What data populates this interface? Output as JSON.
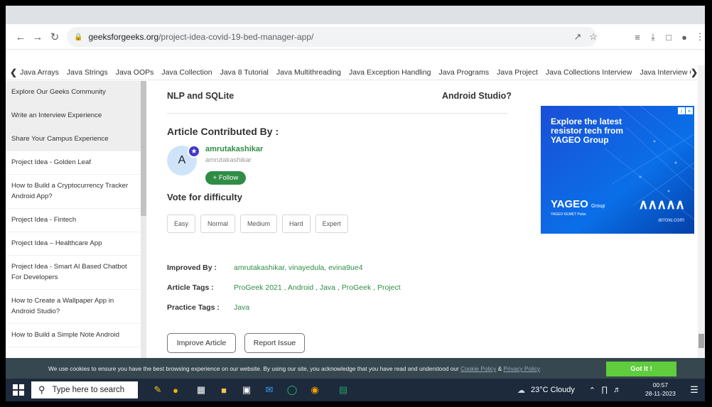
{
  "browser": {
    "url_domain": "geeksforgeeks.org",
    "url_path": "/project-idea-covid-19-bed-manager-app/"
  },
  "topics": [
    "Java Arrays",
    "Java Strings",
    "Java OOPs",
    "Java Collection",
    "Java 8 Tutorial",
    "Java Multithreading",
    "Java Exception Handling",
    "Java Programs",
    "Java Project",
    "Java Collections Interview",
    "Java Interview Qu"
  ],
  "sidebar": {
    "items": [
      {
        "label": "Explore Our Geeks Community",
        "highlight": true
      },
      {
        "label": "Write an Interview Experience",
        "highlight": true
      },
      {
        "label": "Share Your Campus Experience",
        "highlight": true
      },
      {
        "label": "Project Idea - Golden Leaf",
        "highlight": false
      },
      {
        "label": "How to Build a Cryptocurrency Tracker Android App?",
        "highlight": false
      },
      {
        "label": "Project Idea - Fintech",
        "highlight": false
      },
      {
        "label": "Project Idea – Healthcare App",
        "highlight": false
      },
      {
        "label": "Project Idea - Smart AI Based Chatbot For Developers",
        "highlight": false
      },
      {
        "label": "How to Create a Wallpaper App in Android Studio?",
        "highlight": false
      },
      {
        "label": "How to Build a Simple Note Android",
        "highlight": false
      }
    ]
  },
  "main": {
    "prev_related": "NLP and SQLite",
    "next_related": "Android Studio?",
    "contributed_title": "Article Contributed By :",
    "author": {
      "initial": "A",
      "name": "amrutakashikar",
      "handle": "amrutakashikar",
      "follow_label": "+ Follow"
    },
    "vote_title": "Vote for difficulty",
    "vote_options": [
      "Easy",
      "Normal",
      "Medium",
      "Hard",
      "Expert"
    ],
    "improved_by_label": "Improved By :",
    "improved_by": "amrutakashikar,  vinayedula,  evina9ue4",
    "article_tags_label": "Article Tags :",
    "article_tags": "ProGeek 2021 ,  Android ,  Java ,  ProGeek ,  Project",
    "practice_tags_label": "Practice Tags :",
    "practice_tags": "Java",
    "improve_label": "Improve Article",
    "report_label": "Report Issue"
  },
  "ad": {
    "headline": "Explore the latest resistor tech from YAGEO Group",
    "brand": "YAGEO",
    "brand_suffix": "Group",
    "sub": "YAGEO  KEMET  Pulse",
    "partner": "∧∧∧∧∧",
    "partner_name": "arrow.com",
    "close_icons": [
      "i",
      "×"
    ]
  },
  "cookie": {
    "text": "We use cookies to ensure you have the best browsing experience on our website. By using our site, you acknowledge that you have read and understood our ",
    "cookie_policy": "Cookie Policy",
    "amp": " & ",
    "privacy_policy": "Privacy Policy",
    "button": "Got It !"
  },
  "taskbar": {
    "search_placeholder": "Type here to search",
    "weather": "23°C  Cloudy",
    "time": "00:57",
    "date": "28-11-2023"
  }
}
